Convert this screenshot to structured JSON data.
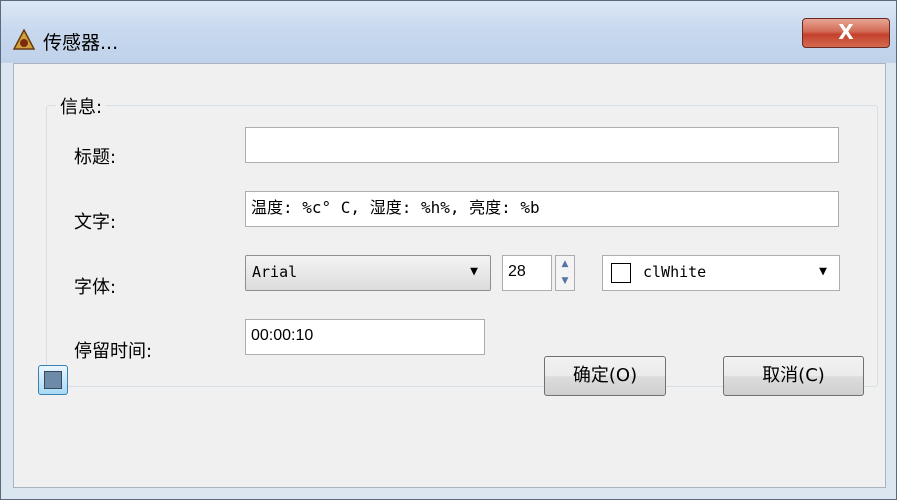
{
  "window": {
    "title": "传感器...",
    "close_label": "X"
  },
  "group": {
    "label": "信息:"
  },
  "fields": {
    "title_label": "标题:",
    "title_value": "",
    "text_label": "文字:",
    "text_value": "温度: %c° C, 湿度: %h%, 亮度: %b",
    "font_label": "字体:",
    "font_name": "Arial",
    "font_size": "28",
    "font_color": "clWhite",
    "duration_label": "停留时间:",
    "duration_value": "00:00:10"
  },
  "buttons": {
    "ok": "确定(O)",
    "cancel": "取消(C)"
  },
  "icons": {
    "app": "sensor-app-icon",
    "tool": "edit-tool-icon",
    "dropdown": "chevron-down-icon",
    "spin_up": "spin-up-icon",
    "spin_down": "spin-down-icon"
  },
  "colors": {
    "titlebar": "#c7d8ee",
    "close_button": "#c4412c",
    "dialog_bg": "#f0f0f0"
  }
}
